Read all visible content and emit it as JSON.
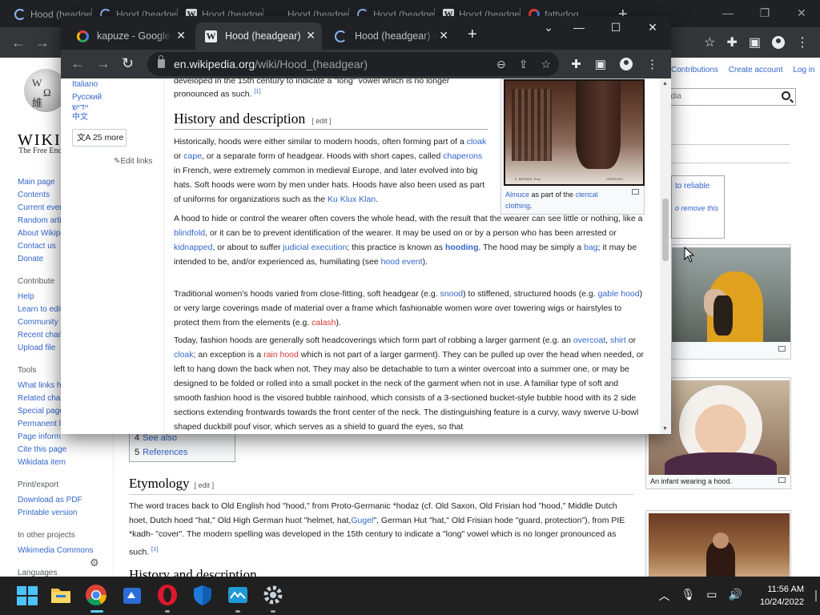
{
  "bg_browser": {
    "tabs": [
      {
        "title": "Hood (headgear)"
      },
      {
        "title": "Hood (headgear)"
      },
      {
        "title": "Hood (headgear)"
      },
      {
        "title": "Hood (headgear)"
      },
      {
        "title": "Hood (headgear)"
      },
      {
        "title": "Hood (headgear)"
      },
      {
        "title": "fattydog"
      }
    ],
    "new_tab": "+"
  },
  "bg_page": {
    "wordmark": "WIKIPEDIA",
    "tagline": "The Free Encyclopedia",
    "top_links": [
      "Contributions",
      "Create account",
      "Log in"
    ],
    "search_placeholder": "Search Wikipedia",
    "ambox": {
      "line1": "to reliable",
      "line2": "o remove this"
    },
    "sidebar": {
      "main": [
        "Main page",
        "Contents",
        "Current events",
        "Random article",
        "About Wikipedia",
        "Contact us",
        "Donate"
      ],
      "contribute_heading": "Contribute",
      "contribute": [
        "Help",
        "Learn to edit",
        "Community portal",
        "Recent changes",
        "Upload file"
      ],
      "tools_heading": "Tools",
      "tools": [
        "What links here",
        "Related changes",
        "Special pages",
        "Permanent link",
        "Page information",
        "Cite this page",
        "Wikidata item"
      ],
      "print_heading": "Print/export",
      "print": [
        "Download as PDF",
        "Printable version"
      ],
      "projects_heading": "In other projects",
      "projects": [
        "Wikimedia Commons"
      ],
      "languages_heading": "Languages"
    },
    "toc": [
      {
        "num": "4",
        "text": "See also"
      },
      {
        "num": "5",
        "text": "References"
      }
    ],
    "etymology_heading": "Etymology",
    "edit_label": "[ edit ]",
    "etymology_text": "The word traces back to Old English hod \"hood,\" from Proto-Germanic *hodaz (cf. Old Saxon, Old Frisian hod \"hood,\" Middle Dutch hoet, Dutch hoed \"hat,\" Old High German huot \"helmet, hat,",
    "etymology_gugel": "Gugel",
    "etymology_text2": "\", German Hut \"hat,\" Old Frisian hode \"guard, protection\"), from PIE *kadh- \"cover\". The modern spelling was developed in the 15th century to indicate a \"long\" vowel which is no longer pronounced as such.",
    "ref1": "[1]",
    "history_heading_partial": "History and description",
    "infant_caption": "An infant wearing a hood."
  },
  "fg_browser": {
    "tabs": [
      {
        "title": "kapuze - Google Search"
      },
      {
        "title": "Hood (headgear)"
      },
      {
        "title": "Hood (headgear) - Wikipedia"
      }
    ],
    "new_tab": "+",
    "url_host": "en.wikipedia.org",
    "url_path": "/wiki/Hood_(headgear)"
  },
  "fg_page": {
    "languages": [
      "Italiano",
      "Русский",
      "ייִדיש",
      "中文"
    ],
    "more_languages": "25 more",
    "edit_links": "Edit links",
    "top_fragment": "developed in the 15th century to indicate a \"long\" vowel which is no longer",
    "top_fragment2": "pronounced as such.",
    "ref1": "[1]",
    "heading": "History and description",
    "edit_label": "[ edit ]",
    "p1": {
      "t1": "Historically, hoods were either similar to modern hoods, often forming part of a",
      "cloak": "cloak",
      "or": " or ",
      "cape": "cape",
      "t2": ", or a separate form of headgear. Hoods with short capes, called",
      "chaperons": "chaperons",
      "t3": " in French, were extremely common in medieval Europe, and later evolved into big hats. Soft hoods were worn by men under hats. Hoods have also been used as part of uniforms for organizations such as the ",
      "kkk": "Ku Klux Klan",
      "t4": "."
    },
    "p2": {
      "t1": "A hood to hide or control the wearer often covers the whole head, with the result that the wearer can see little or nothing, like a ",
      "blindfold": "blindfold",
      "t2": ", or it can be to prevent identification of the wearer. It may be used on or by a person who has been arrested or ",
      "kidnapped": "kidnapped",
      "t3": ", or about to suffer ",
      "judicial": "judicial execution",
      "t4": "; this practice is known as ",
      "hooding": "hooding",
      "t5": ". The hood may be simply a ",
      "bag": "bag",
      "t6": "; it may be intended to be, and/or experienced as, humiliating (see ",
      "hood_event": "hood event",
      "t7": ")."
    },
    "p3": {
      "t1": "Traditional women's hoods varied from close-fitting, soft headgear (e.g. ",
      "snood": "snood",
      "t2": ") to stiffened, structured hoods (e.g. ",
      "gable": "gable hood",
      "t3": ") or very large coverings made of material over a frame which fashionable women wore over towering wigs or hairstyles to protect them from the elements (e.g. ",
      "calash": "calash",
      "t4": ")."
    },
    "p4": {
      "t1": "Today, fashion hoods are generally soft headcoverings which form part of robbing a larger garment (e.g. an ",
      "overcoat": "overcoat",
      "t2": ", ",
      "shirt": "shirt",
      "t3": " or ",
      "cloak": "cloak",
      "t4": "; an exception is a ",
      "rain_hood": "rain hood",
      "t5": " which is not part of a larger garment). They can be pulled up over the head when needed, or left to hang down the back when not. They may also be detachable to turn a winter overcoat into a summer one, or may be designed to be folded or rolled into a small pocket in the neck of the garment when not in use. A familiar type of soft and smooth fashion hood is the visored bubble rainhood, which consists of a 3-sectioned bucket-style bubble hood with its 2 side sections extending frontwards towards the front center of the neck. The distinguishing feature is a curvy, wavy swerve U-bowl shaped duckbill pouf visor, which serves as a shield to guard the eyes, so that"
    },
    "thumb": {
      "photographer": "E. BERNER, Phot.",
      "town": "FRIBOURG.",
      "caption_link": "Almuce",
      "caption_mid": " as part of the ",
      "caption_link2": "clerical clothing",
      "caption_end": "."
    }
  },
  "taskbar": {
    "time": "11:56 AM",
    "date": "10/24/2022",
    "apps": [
      "start",
      "file-explorer",
      "chrome",
      "app-blue",
      "opera",
      "security",
      "weather",
      "settings"
    ]
  }
}
